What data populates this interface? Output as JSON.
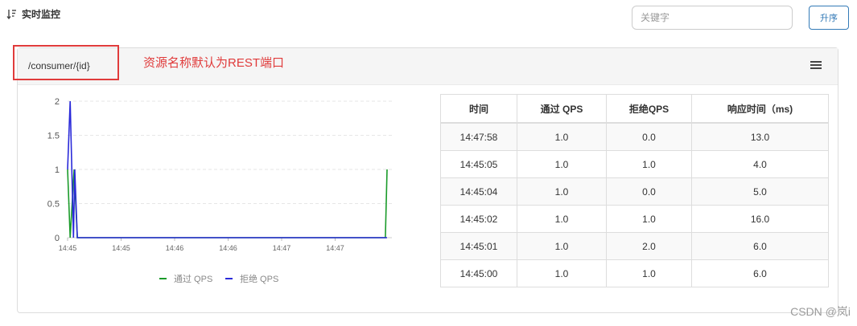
{
  "header": {
    "title": "实时监控",
    "sort_icon": "sort-descending-icon"
  },
  "search": {
    "placeholder": "关键字",
    "value": ""
  },
  "sort_button": {
    "label": "升序"
  },
  "card": {
    "resource": "/consumer/{id}",
    "annotation": "资源名称默认为REST端口",
    "menu_icon": "hamburger-menu-icon"
  },
  "colors": {
    "pass": "#1a9b2a",
    "block": "#2a2ad9",
    "annotation": "#e03b3b",
    "button": "#337ab7"
  },
  "chart_data": {
    "type": "line",
    "x_ticks": [
      "14:45",
      "14:45",
      "14:46",
      "14:46",
      "14:47",
      "14:47"
    ],
    "x_tick_fractions": [
      0,
      0.165,
      0.33,
      0.495,
      0.66,
      0.825
    ],
    "ylim": [
      0,
      2
    ],
    "y_ticks": [
      "0",
      "0.5",
      "1",
      "1.5",
      "2"
    ],
    "grid": "horizontal dashed",
    "legend_position": "bottom-center",
    "series": [
      {
        "name": "通过 QPS",
        "color": "#1a9b2a",
        "points": [
          [
            0,
            1
          ],
          [
            0.008,
            0
          ],
          [
            0.02,
            1
          ],
          [
            0.03,
            0
          ],
          [
            0.98,
            0
          ],
          [
            0.985,
            1
          ]
        ]
      },
      {
        "name": "拒绝 QPS",
        "color": "#2a2ad9",
        "points": [
          [
            0,
            1
          ],
          [
            0.008,
            2
          ],
          [
            0.018,
            0
          ],
          [
            0.022,
            1
          ],
          [
            0.03,
            0
          ],
          [
            0.985,
            0
          ]
        ]
      }
    ]
  },
  "table": {
    "columns": [
      "时间",
      "通过 QPS",
      "拒绝QPS",
      "响应时间（ms)"
    ],
    "rows": [
      [
        "14:47:58",
        "1.0",
        "0.0",
        "13.0"
      ],
      [
        "14:45:05",
        "1.0",
        "1.0",
        "4.0"
      ],
      [
        "14:45:04",
        "1.0",
        "0.0",
        "5.0"
      ],
      [
        "14:45:02",
        "1.0",
        "1.0",
        "16.0"
      ],
      [
        "14:45:01",
        "1.0",
        "2.0",
        "6.0"
      ],
      [
        "14:45:00",
        "1.0",
        "1.0",
        "6.0"
      ]
    ]
  },
  "watermark": "CSDN @岚i"
}
